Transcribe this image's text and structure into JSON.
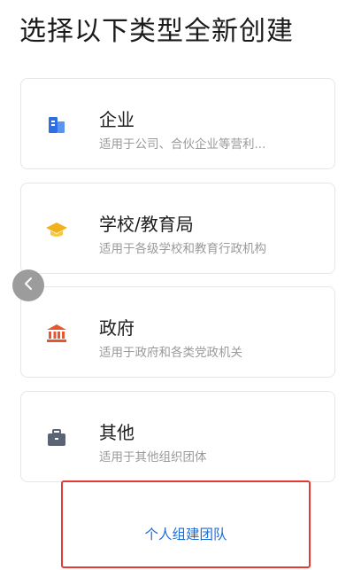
{
  "page": {
    "title": "选择以下类型全新创建"
  },
  "types": [
    {
      "title": "企业",
      "subtitle": "适用于公司、合伙企业等营利...",
      "icon": "building-icon",
      "color": "#2f6fe0"
    },
    {
      "title": "学校/教育局",
      "subtitle": "适用于各级学校和教育行政机构",
      "icon": "graduation-cap-icon",
      "color": "#f2b21b"
    },
    {
      "title": "政府",
      "subtitle": "适用于政府和各类党政机关",
      "icon": "government-building-icon",
      "color": "#e8562f"
    },
    {
      "title": "其他",
      "subtitle": "适用于其他组织团体",
      "icon": "briefcase-icon",
      "color": "#5b6475"
    }
  ],
  "back_button": {
    "icon": "chevron-left-icon"
  },
  "personal": {
    "label": "个人组建团队",
    "color": "#1e6bd6"
  }
}
